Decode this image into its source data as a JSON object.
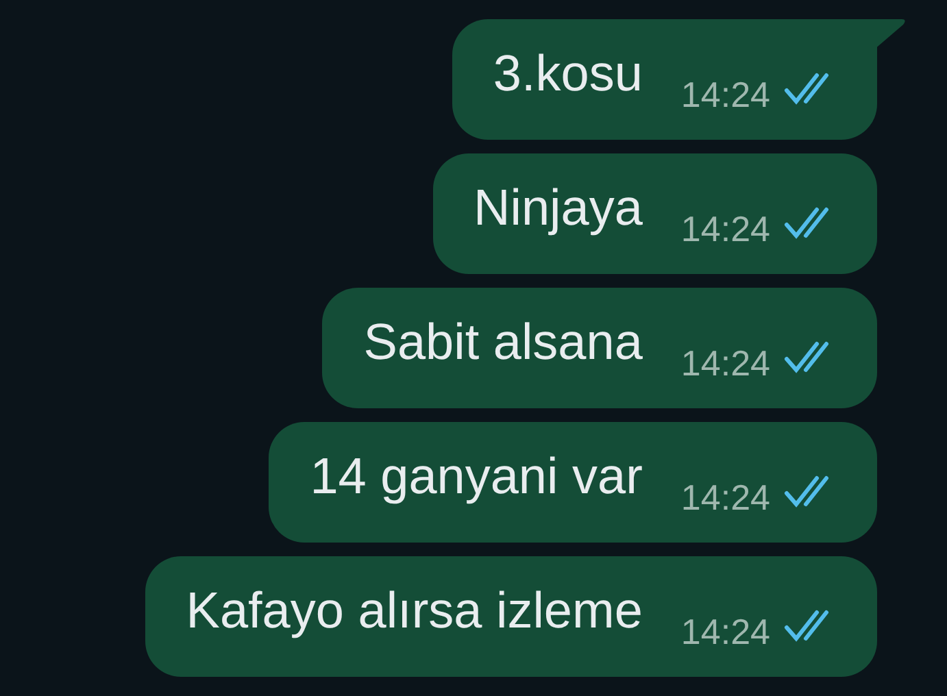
{
  "messages": [
    {
      "text": "3.kosu",
      "time": "14:24",
      "read": true,
      "tail": true
    },
    {
      "text": "Ninjaya",
      "time": "14:24",
      "read": true,
      "tail": false
    },
    {
      "text": "Sabit alsana",
      "time": "14:24",
      "read": true,
      "tail": false
    },
    {
      "text": "14 ganyani var",
      "time": "14:24",
      "read": true,
      "tail": false
    },
    {
      "text": "Kafayo alırsa izleme",
      "time": "14:24",
      "read": true,
      "tail": false
    }
  ]
}
